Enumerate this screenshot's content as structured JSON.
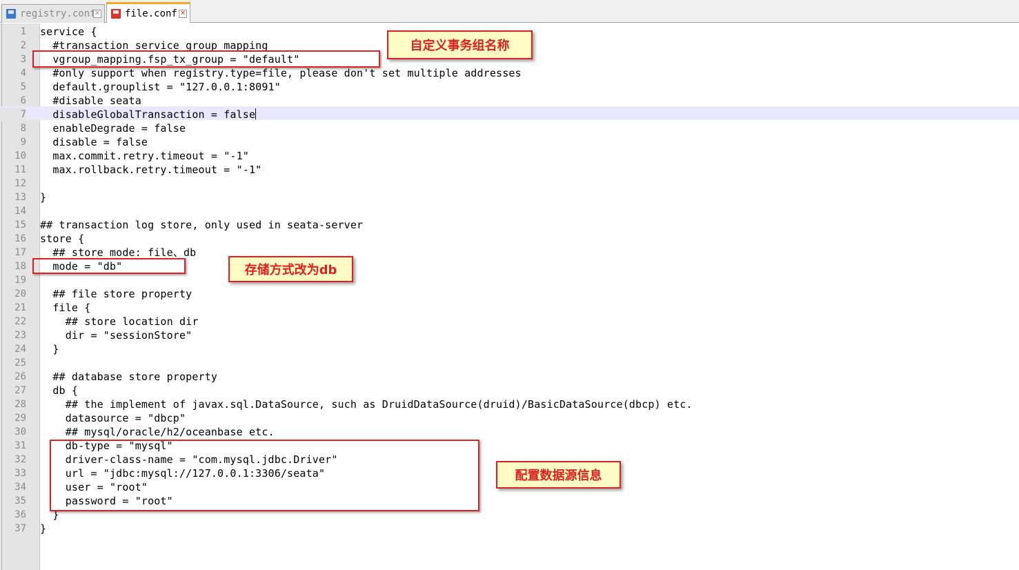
{
  "tabs": [
    {
      "label": "registry.conf",
      "active": false
    },
    {
      "label": "file.conf",
      "active": true
    }
  ],
  "editor": {
    "current_line": 7,
    "lines": [
      "service {",
      "  #transaction service group mapping",
      "  vgroup_mapping.fsp_tx_group = \"default\"",
      "  #only support when registry.type=file, please don't set multiple addresses",
      "  default.grouplist = \"127.0.0.1:8091\"",
      "  #disable seata",
      "  disableGlobalTransaction = false",
      "  enableDegrade = false",
      "  disable = false",
      "  max.commit.retry.timeout = \"-1\"",
      "  max.rollback.retry.timeout = \"-1\"",
      "",
      "}",
      "",
      "## transaction log store, only used in seata-server",
      "store {",
      "  ## store mode: file、db",
      "  mode = \"db\"",
      "",
      "  ## file store property",
      "  file {",
      "    ## store location dir",
      "    dir = \"sessionStore\"",
      "  }",
      "",
      "  ## database store property",
      "  db {",
      "    ## the implement of javax.sql.DataSource, such as DruidDataSource(druid)/BasicDataSource(dbcp) etc.",
      "    datasource = \"dbcp\"",
      "    ## mysql/oracle/h2/oceanbase etc.",
      "    db-type = \"mysql\"",
      "    driver-class-name = \"com.mysql.jdbc.Driver\"",
      "    url = \"jdbc:mysql://127.0.0.1:3306/seata\"",
      "    user = \"root\"",
      "    password = \"root\"",
      "  }",
      "}"
    ]
  },
  "annotations": {
    "group_name": "自定义事务组名称",
    "store_mode": "存储方式改为db",
    "datasource_info": "配置数据源信息"
  },
  "colors": {
    "annotation_red": "#e02020",
    "callout_fill": "#fffbc4",
    "current_line": "#e8e8ff",
    "active_tab_accent": "#f5a623"
  }
}
